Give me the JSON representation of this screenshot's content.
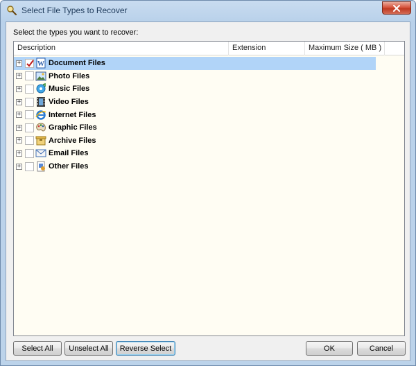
{
  "window": {
    "title": "Select File Types to Recover"
  },
  "prompt": "Select the types you want to recover:",
  "columns": [
    "Description",
    "Extension",
    "Maximum Size ( MB )"
  ],
  "rows": [
    {
      "label": "Document Files",
      "checked": true,
      "selected": true,
      "icon": "word-document-icon"
    },
    {
      "label": "Photo Files",
      "checked": false,
      "selected": false,
      "icon": "photo-icon"
    },
    {
      "label": "Music Files",
      "checked": false,
      "selected": false,
      "icon": "music-icon"
    },
    {
      "label": "Video Files",
      "checked": false,
      "selected": false,
      "icon": "film-icon"
    },
    {
      "label": "Internet Files",
      "checked": false,
      "selected": false,
      "icon": "internet-explorer-icon"
    },
    {
      "label": "Graphic Files",
      "checked": false,
      "selected": false,
      "icon": "paint-palette-icon"
    },
    {
      "label": "Archive Files",
      "checked": false,
      "selected": false,
      "icon": "archive-icon"
    },
    {
      "label": "Email Files",
      "checked": false,
      "selected": false,
      "icon": "envelope-icon"
    },
    {
      "label": "Other Files",
      "checked": false,
      "selected": false,
      "icon": "other-files-icon"
    }
  ],
  "buttons": {
    "select_all": "Select All",
    "unselect_all": "Unselect All",
    "reverse_select": "Reverse Select",
    "ok": "OK",
    "cancel": "Cancel"
  },
  "expander_symbol": "+"
}
